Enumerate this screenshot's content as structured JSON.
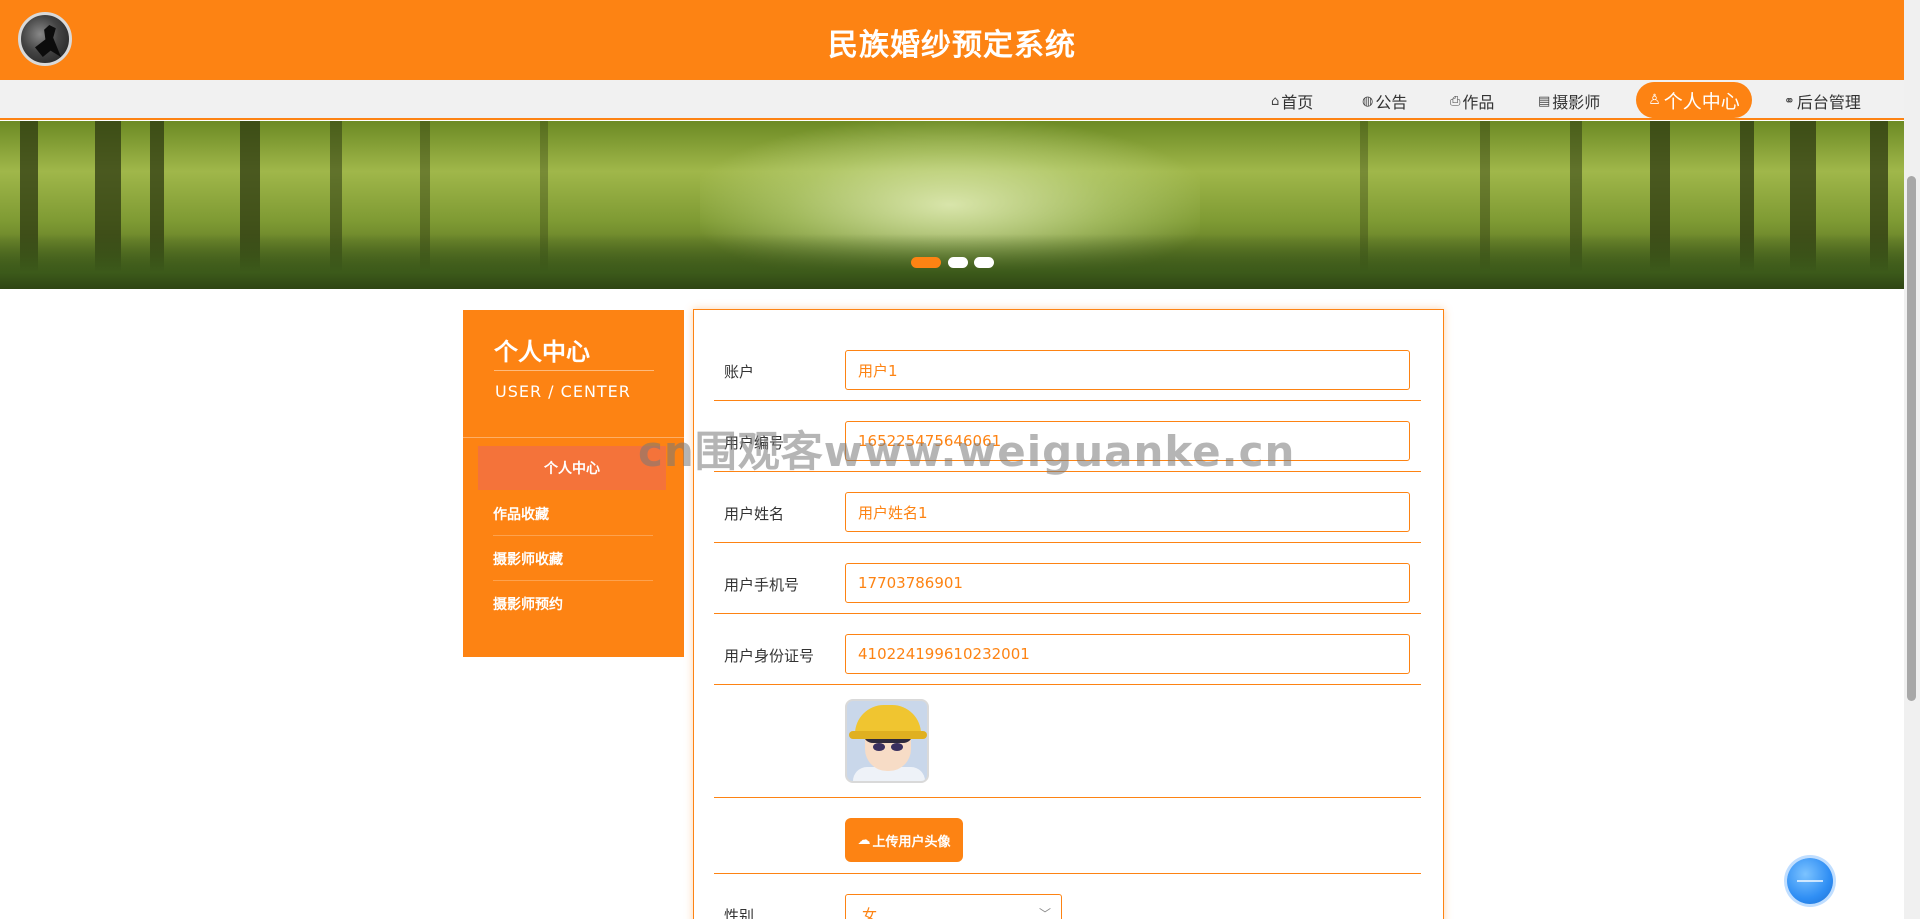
{
  "header": {
    "title": "民族婚纱预定系统"
  },
  "nav": {
    "items": [
      {
        "label": "首页",
        "icon": "home-icon"
      },
      {
        "label": "公告",
        "icon": "globe-icon"
      },
      {
        "label": "作品",
        "icon": "printer-icon"
      },
      {
        "label": "摄影师",
        "icon": "clipboard-icon"
      },
      {
        "label": "个人中心",
        "icon": "user-icon",
        "active": true
      },
      {
        "label": "后台管理",
        "icon": "link-icon"
      }
    ]
  },
  "banner": {
    "slides": 3,
    "active_slide": 1
  },
  "sidebar": {
    "title": "个人中心",
    "subtitle": "USER / CENTER",
    "items": [
      {
        "label": "个人中心",
        "active": true
      },
      {
        "label": "作品收藏"
      },
      {
        "label": "摄影师收藏"
      },
      {
        "label": "摄影师预约"
      }
    ]
  },
  "form": {
    "fields": [
      {
        "label": "账户",
        "value": "用户1"
      },
      {
        "label": "用户编号",
        "value": "165225475646061"
      },
      {
        "label": "用户姓名",
        "value": "用户姓名1"
      },
      {
        "label": "用户手机号",
        "value": "17703786901"
      },
      {
        "label": "用户身份证号",
        "value": "410224199610232001"
      }
    ],
    "upload_label": "上传用户头像",
    "gender_label": "性别",
    "gender_value": "女"
  },
  "watermark": "cn围观客www.weiguanke.cn",
  "colors": {
    "accent": "#fd8313",
    "sidebar_active": "#f4733a",
    "nav_bg": "#f1f1f1"
  }
}
